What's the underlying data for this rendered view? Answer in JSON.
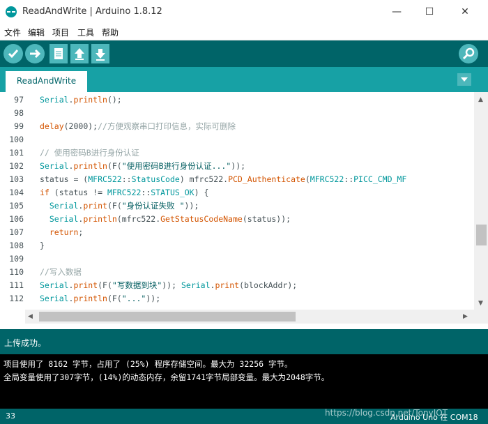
{
  "window": {
    "title": "ReadAndWrite | Arduino 1.8.12",
    "min_label": "—",
    "max_label": "☐",
    "close_label": "✕"
  },
  "menu": [
    "文件",
    "编辑",
    "项目",
    "工具",
    "帮助"
  ],
  "toolbar": {
    "verify_icon": "✓",
    "upload_icon": "→",
    "new_icon": "▯",
    "open_icon": "⬆",
    "save_icon": "⬇",
    "monitor_icon": "⌕"
  },
  "tab": {
    "label": "ReadAndWrite"
  },
  "editor": {
    "lines": [
      {
        "n": "97",
        "parts": [
          [
            "ty",
            "Serial"
          ],
          [
            "",
            "."
          ],
          [
            "fn",
            "println"
          ],
          [
            "",
            "();"
          ]
        ]
      },
      {
        "n": "98",
        "parts": []
      },
      {
        "n": "99",
        "parts": [
          [
            "fn",
            "delay"
          ],
          [
            "",
            "(2000);"
          ],
          [
            "co",
            "//方便观察串口打印信息，实际可删除"
          ]
        ]
      },
      {
        "n": "100",
        "parts": []
      },
      {
        "n": "101",
        "parts": [
          [
            "co",
            "// 使用密码B进行身份认证"
          ]
        ]
      },
      {
        "n": "102",
        "parts": [
          [
            "ty",
            "Serial"
          ],
          [
            "",
            "."
          ],
          [
            "fn",
            "println"
          ],
          [
            "",
            "(F("
          ],
          [
            "st",
            "\"使用密码B进行身份认证...\""
          ],
          [
            "",
            "));"
          ]
        ]
      },
      {
        "n": "103",
        "parts": [
          [
            "",
            "status = ("
          ],
          [
            "ty",
            "MFRC522"
          ],
          [
            "",
            "::"
          ],
          [
            "ty",
            "StatusCode"
          ],
          [
            "",
            ") mfrc522."
          ],
          [
            "fn",
            "PCD_Authenticate"
          ],
          [
            "",
            "("
          ],
          [
            "ty",
            "MFRC522"
          ],
          [
            "",
            "::"
          ],
          [
            "cn",
            "PICC_CMD_MF"
          ]
        ]
      },
      {
        "n": "104",
        "parts": [
          [
            "kw",
            "if"
          ],
          [
            "",
            " (status != "
          ],
          [
            "ty",
            "MFRC522"
          ],
          [
            "",
            "::"
          ],
          [
            "cn",
            "STATUS_OK"
          ],
          [
            "",
            ") {"
          ]
        ]
      },
      {
        "n": "105",
        "parts": [
          [
            "",
            "  "
          ],
          [
            "ty",
            "Serial"
          ],
          [
            "",
            "."
          ],
          [
            "fn",
            "print"
          ],
          [
            "",
            "(F("
          ],
          [
            "st",
            "\"身份认证失败 \""
          ],
          [
            "",
            "));"
          ]
        ]
      },
      {
        "n": "106",
        "parts": [
          [
            "",
            "  "
          ],
          [
            "ty",
            "Serial"
          ],
          [
            "",
            "."
          ],
          [
            "fn",
            "println"
          ],
          [
            "",
            "(mfrc522."
          ],
          [
            "fn",
            "GetStatusCodeName"
          ],
          [
            "",
            "(status));"
          ]
        ]
      },
      {
        "n": "107",
        "parts": [
          [
            "",
            "  "
          ],
          [
            "kw",
            "return"
          ],
          [
            "",
            ";"
          ]
        ]
      },
      {
        "n": "108",
        "parts": [
          [
            "",
            "}"
          ]
        ]
      },
      {
        "n": "109",
        "parts": []
      },
      {
        "n": "110",
        "parts": [
          [
            "co",
            "//写入数据"
          ]
        ]
      },
      {
        "n": "111",
        "parts": [
          [
            "ty",
            "Serial"
          ],
          [
            "",
            "."
          ],
          [
            "fn",
            "print"
          ],
          [
            "",
            "(F("
          ],
          [
            "st",
            "\"写数据到块\""
          ],
          [
            "",
            "));"
          ],
          [
            "",
            " "
          ],
          [
            "ty",
            "Serial"
          ],
          [
            "",
            "."
          ],
          [
            "fn",
            "print"
          ],
          [
            "",
            "(blockAddr);"
          ]
        ]
      },
      {
        "n": "112",
        "parts": [
          [
            "ty",
            "Serial"
          ],
          [
            "",
            "."
          ],
          [
            "fn",
            "println"
          ],
          [
            "",
            "(F("
          ],
          [
            "st",
            "\"...\""
          ],
          [
            "",
            "));"
          ]
        ]
      }
    ]
  },
  "status": {
    "message": "上传成功。"
  },
  "console": {
    "lines": [
      "项目使用了 8162 字节，占用了 (25%) 程序存储空间。最大为 32256 字节。",
      "全局变量使用了307字节，(14%)的动态内存，余留1741字节局部变量。最大为2048字节。"
    ]
  },
  "footer": {
    "line_number": "33",
    "board": "Arduino Uno 在 COM18",
    "watermark": "https://blog.csdn.net/TonyIOT"
  },
  "colors": {
    "teal_dark": "#006468",
    "teal_mid": "#17a1a5",
    "teal_light": "#4db7bb",
    "keyword": "#d35400",
    "type": "#00979c"
  }
}
